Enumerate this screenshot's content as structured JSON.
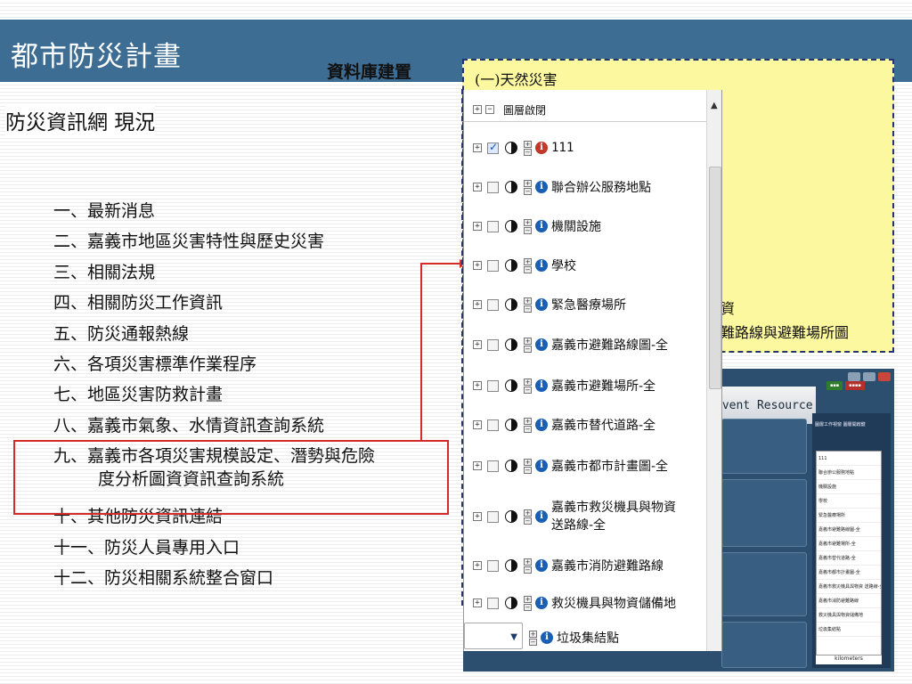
{
  "slide_title": "都市防災計畫",
  "db_label": "資料庫建置",
  "subtitle": "防災資訊網 現況",
  "menu": [
    {
      "text": "一、最新消息"
    },
    {
      "text": "二、嘉義市地區災害特性與歷史災害"
    },
    {
      "text": "三、相關法規"
    },
    {
      "text": "四、相關防災工作資訊"
    },
    {
      "text": "五、防災通報熱線"
    },
    {
      "text": "六、各項災害標準作業程序"
    },
    {
      "text": "七、地區災害防救計畫"
    },
    {
      "text": "八、嘉義市氣象、水情資訊查詢系統"
    },
    {
      "text": "九、嘉義市各項災害規模設定、潛勢與危險",
      "line2": "度分析圖資資訊查詢系統"
    },
    {
      "text": "十、其他防災資訊連結"
    },
    {
      "text": "十一、防災人員專用入口"
    },
    {
      "text": "十二、防災相關系統整合窗口"
    }
  ],
  "yellow_box": {
    "title": "(一)天然災害",
    "line1": "資",
    "line2": "難路線與避難場所圖"
  },
  "layer_panel": {
    "header": "圖層啟閉",
    "rows": [
      {
        "label": "111",
        "checked": true,
        "info_color": "red"
      },
      {
        "label": "聯合辦公服務地點",
        "checked": false
      },
      {
        "label": "機關設施",
        "checked": false
      },
      {
        "label": "學校",
        "checked": false
      },
      {
        "label": "緊急醫療場所",
        "checked": false
      },
      {
        "label": "嘉義市避難路線圖-全",
        "checked": false
      },
      {
        "label": "嘉義市避難場所-全",
        "checked": false
      },
      {
        "label": "嘉義市替代道路-全",
        "checked": false
      },
      {
        "label": "嘉義市都市計畫圖-全",
        "checked": false
      },
      {
        "label": "嘉義市救災機具與物資",
        "label2": "送路線-全",
        "checked": false
      },
      {
        "label": "嘉義市消防避難路線",
        "checked": false
      },
      {
        "label": "救災機具與物資儲備地",
        "checked": false
      },
      {
        "label": "垃圾集結點",
        "checked": false
      }
    ]
  },
  "map_panel": {
    "banner": "event Resource",
    "mini_header": "圖層工作視窗 圖層開啟鍵",
    "mini_list": [
      "111",
      "聯合辦公服務地點",
      "機關設施",
      "學校",
      "緊急醫療場所",
      "嘉義市避難路線圖-全",
      "嘉義市避難場所-全",
      "嘉義市替代道路-全",
      "嘉義市都市計畫圖-全",
      "嘉義市救災機具與物資 送路線-全",
      "嘉義市消防避難路線",
      "救災機具與物資儲備地",
      "垃圾集結點"
    ],
    "scale_label": "kilometers"
  },
  "colors": {
    "title_bar": "#3e6d94",
    "highlight": "#d42a2a",
    "yellow_box": "#fbf8a0",
    "map_bg": "#2c4f70"
  }
}
